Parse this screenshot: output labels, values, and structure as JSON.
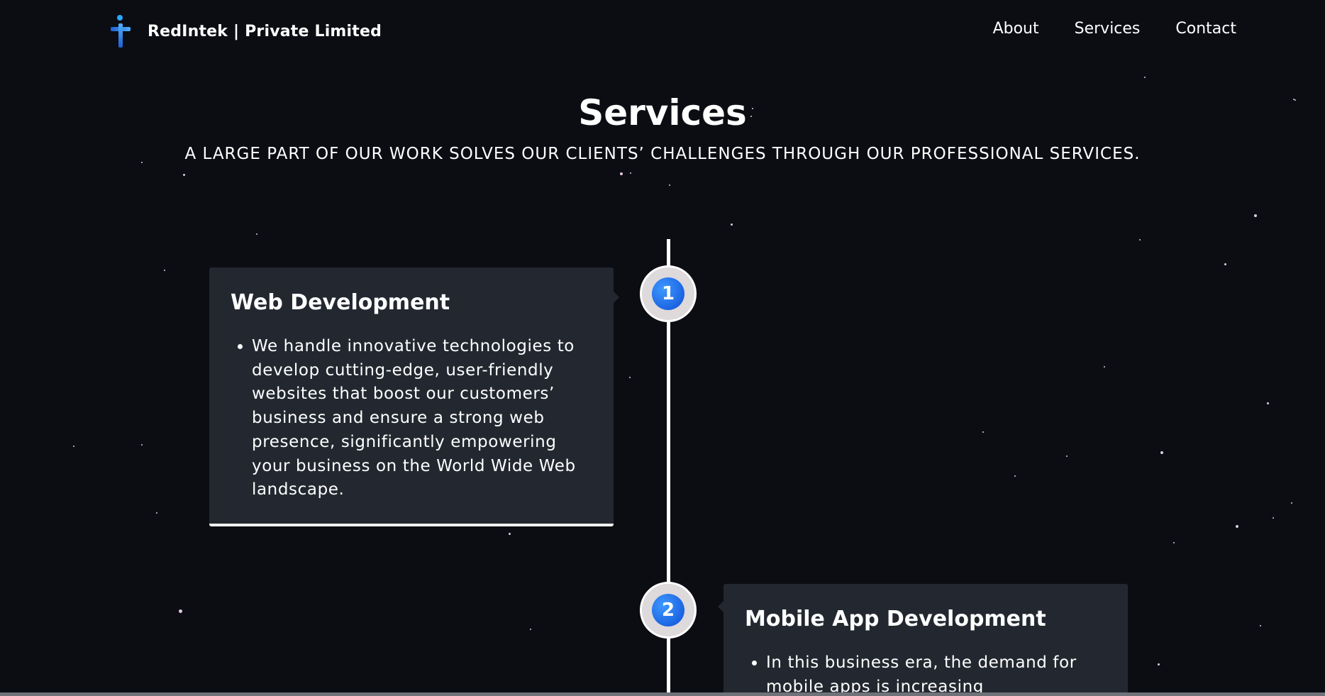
{
  "header": {
    "brand_name": "RedIntek | Private Limited",
    "logo_icon": "redintek-figure-logo",
    "nav": [
      {
        "label": "About"
      },
      {
        "label": "Services"
      },
      {
        "label": "Contact"
      }
    ]
  },
  "services_section": {
    "title": "Services",
    "subtitle": "A LARGE PART OF OUR WORK SOLVES OUR CLIENTS’ CHALLENGES THROUGH OUR PROFESSIONAL SERVICES.",
    "items": [
      {
        "number": "1",
        "title": "Web Development",
        "bullet": "We handle innovative technologies to develop cutting-edge, user-friendly websites that boost our customers’ business and ensure a strong web presence, significantly empowering your business on the World Wide Web landscape."
      },
      {
        "number": "2",
        "title": "Mobile App Development",
        "bullet": "In this business era, the demand for mobile apps is increasing"
      }
    ]
  },
  "colors": {
    "background": "#0b0d13",
    "card": "#232830",
    "marker_ring": "#ded9db",
    "marker_fill": "#1565e0",
    "text": "#ffffff"
  }
}
